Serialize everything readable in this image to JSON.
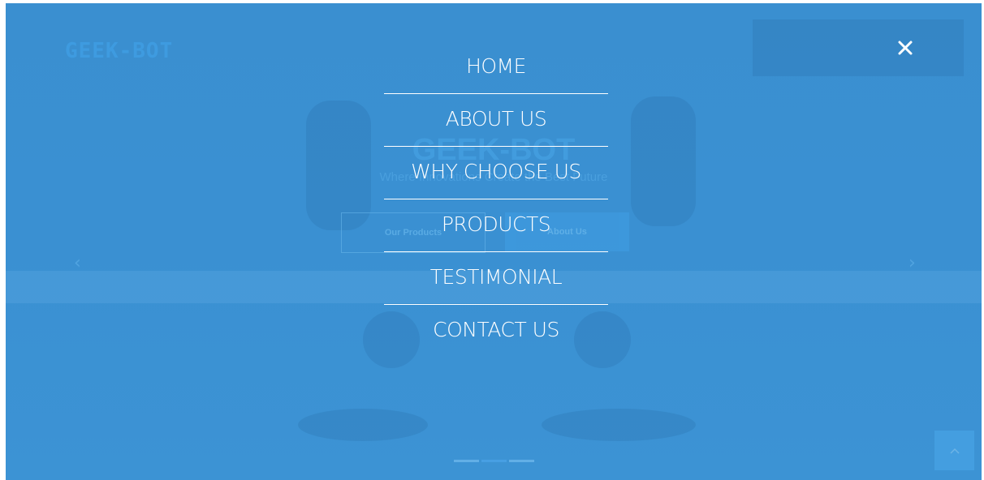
{
  "brand": {
    "logo_text": "GEEK-BOT"
  },
  "hero": {
    "title": "GEEK-BOT",
    "subtitle": "Where Innovations Create the Best Future",
    "primary_button": "Our Products",
    "secondary_button": "About Us"
  },
  "menu": {
    "items": [
      {
        "label": "HOME"
      },
      {
        "label": "ABOUT US"
      },
      {
        "label": "WHY CHOOSE US"
      },
      {
        "label": "PRODUCTS"
      },
      {
        "label": "TESTIMONIAL"
      },
      {
        "label": "CONTACT US"
      }
    ],
    "close_icon": "close-icon"
  },
  "carousel": {
    "slides": 3,
    "active": 2
  },
  "colors": {
    "overlay": "#3a8fd0",
    "text": "#ffffff"
  }
}
